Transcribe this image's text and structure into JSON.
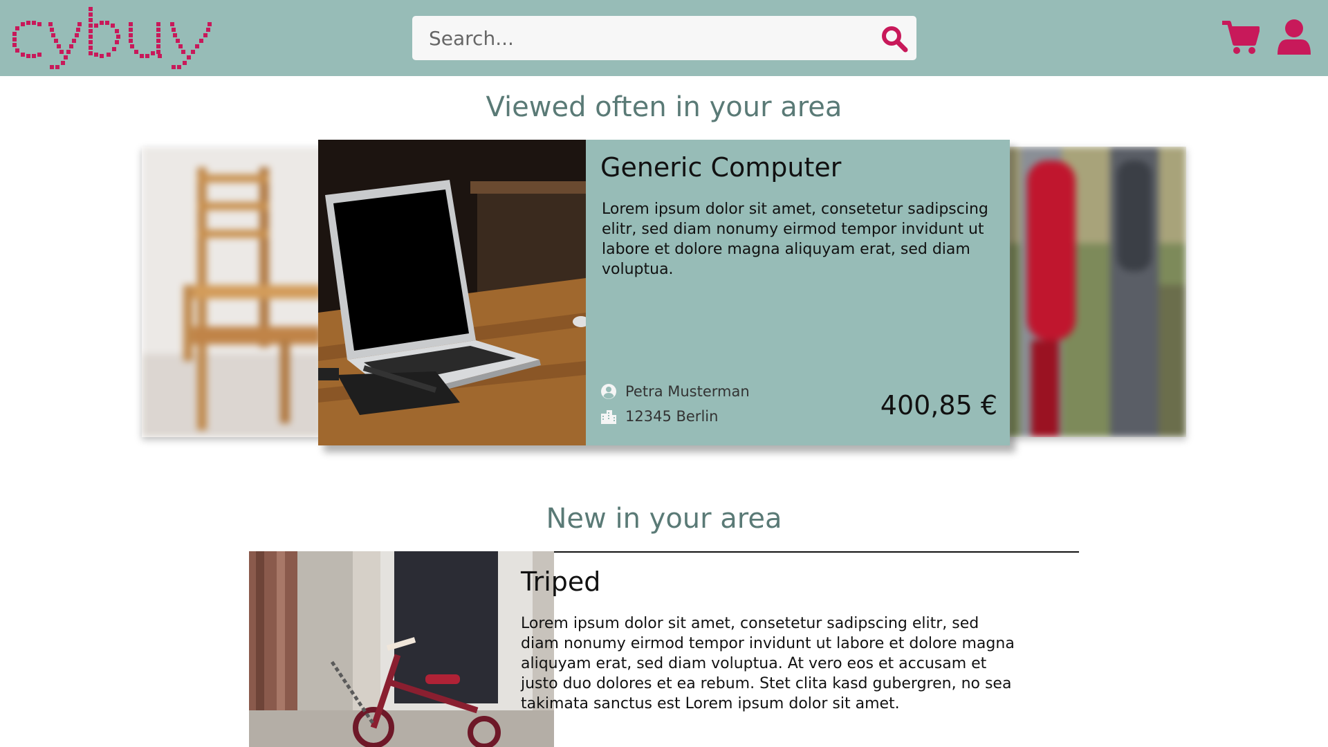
{
  "header": {
    "logo_text": "cybuy",
    "search_placeholder": "Search..."
  },
  "colors": {
    "brand": "#c8195a",
    "header_bg": "#97bcb7",
    "heading": "#5a7a76"
  },
  "sections": {
    "viewed_title": "Viewed often in your area",
    "new_title": "New in your area"
  },
  "featured": {
    "title": "Generic Computer",
    "description": "Lorem ipsum dolor sit amet, consetetur sadipscing elitr, sed diam nonumy eirmod tempor invidunt ut labore et dolore magna aliquyam erat, sed diam voluptua.",
    "seller": "Petra Musterman",
    "location": "12345 Berlin",
    "price": "400,85 €"
  },
  "new_item": {
    "title": "Triped",
    "description": "Lorem ipsum dolor sit amet, consetetur sadipscing elitr, sed diam nonumy eirmod tempor invidunt ut labore et dolore magna aliquyam erat, sed diam voluptua. At vero eos et accusam et justo duo dolores et ea rebum. Stet clita kasd gubergren, no sea takimata sanctus est Lorem ipsum dolor sit amet."
  },
  "icons": {
    "search": "search-icon",
    "cart": "cart-icon",
    "user": "user-icon",
    "seller": "user-circle-icon",
    "location": "city-icon"
  }
}
